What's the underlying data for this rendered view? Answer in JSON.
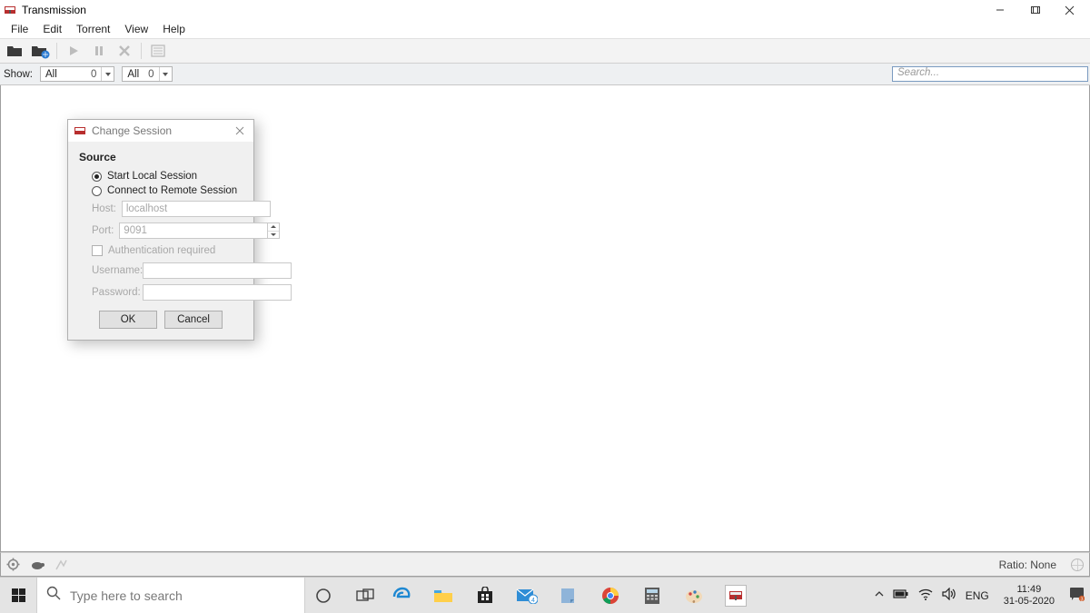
{
  "title": "Transmission",
  "menu": {
    "file": "File",
    "edit": "Edit",
    "torrent": "Torrent",
    "view": "View",
    "help": "Help"
  },
  "filter": {
    "label": "Show:",
    "combo1_text": "All",
    "combo1_count": "0",
    "combo2_text": "All",
    "combo2_count": "0",
    "search_placeholder": "Search..."
  },
  "dialog": {
    "title": "Change Session",
    "section": "Source",
    "opt_local": "Start Local Session",
    "opt_remote": "Connect to Remote Session",
    "host_label": "Host:",
    "host_value": "localhost",
    "port_label": "Port:",
    "port_value": "9091",
    "auth_label": "Authentication required",
    "user_label": "Username:",
    "pass_label": "Password:",
    "ok": "OK",
    "cancel": "Cancel"
  },
  "status": {
    "ratio": "Ratio: None"
  },
  "taskbar": {
    "search": "Type here to search",
    "lang": "ENG",
    "time": "11:49",
    "date": "31-05-2020"
  }
}
